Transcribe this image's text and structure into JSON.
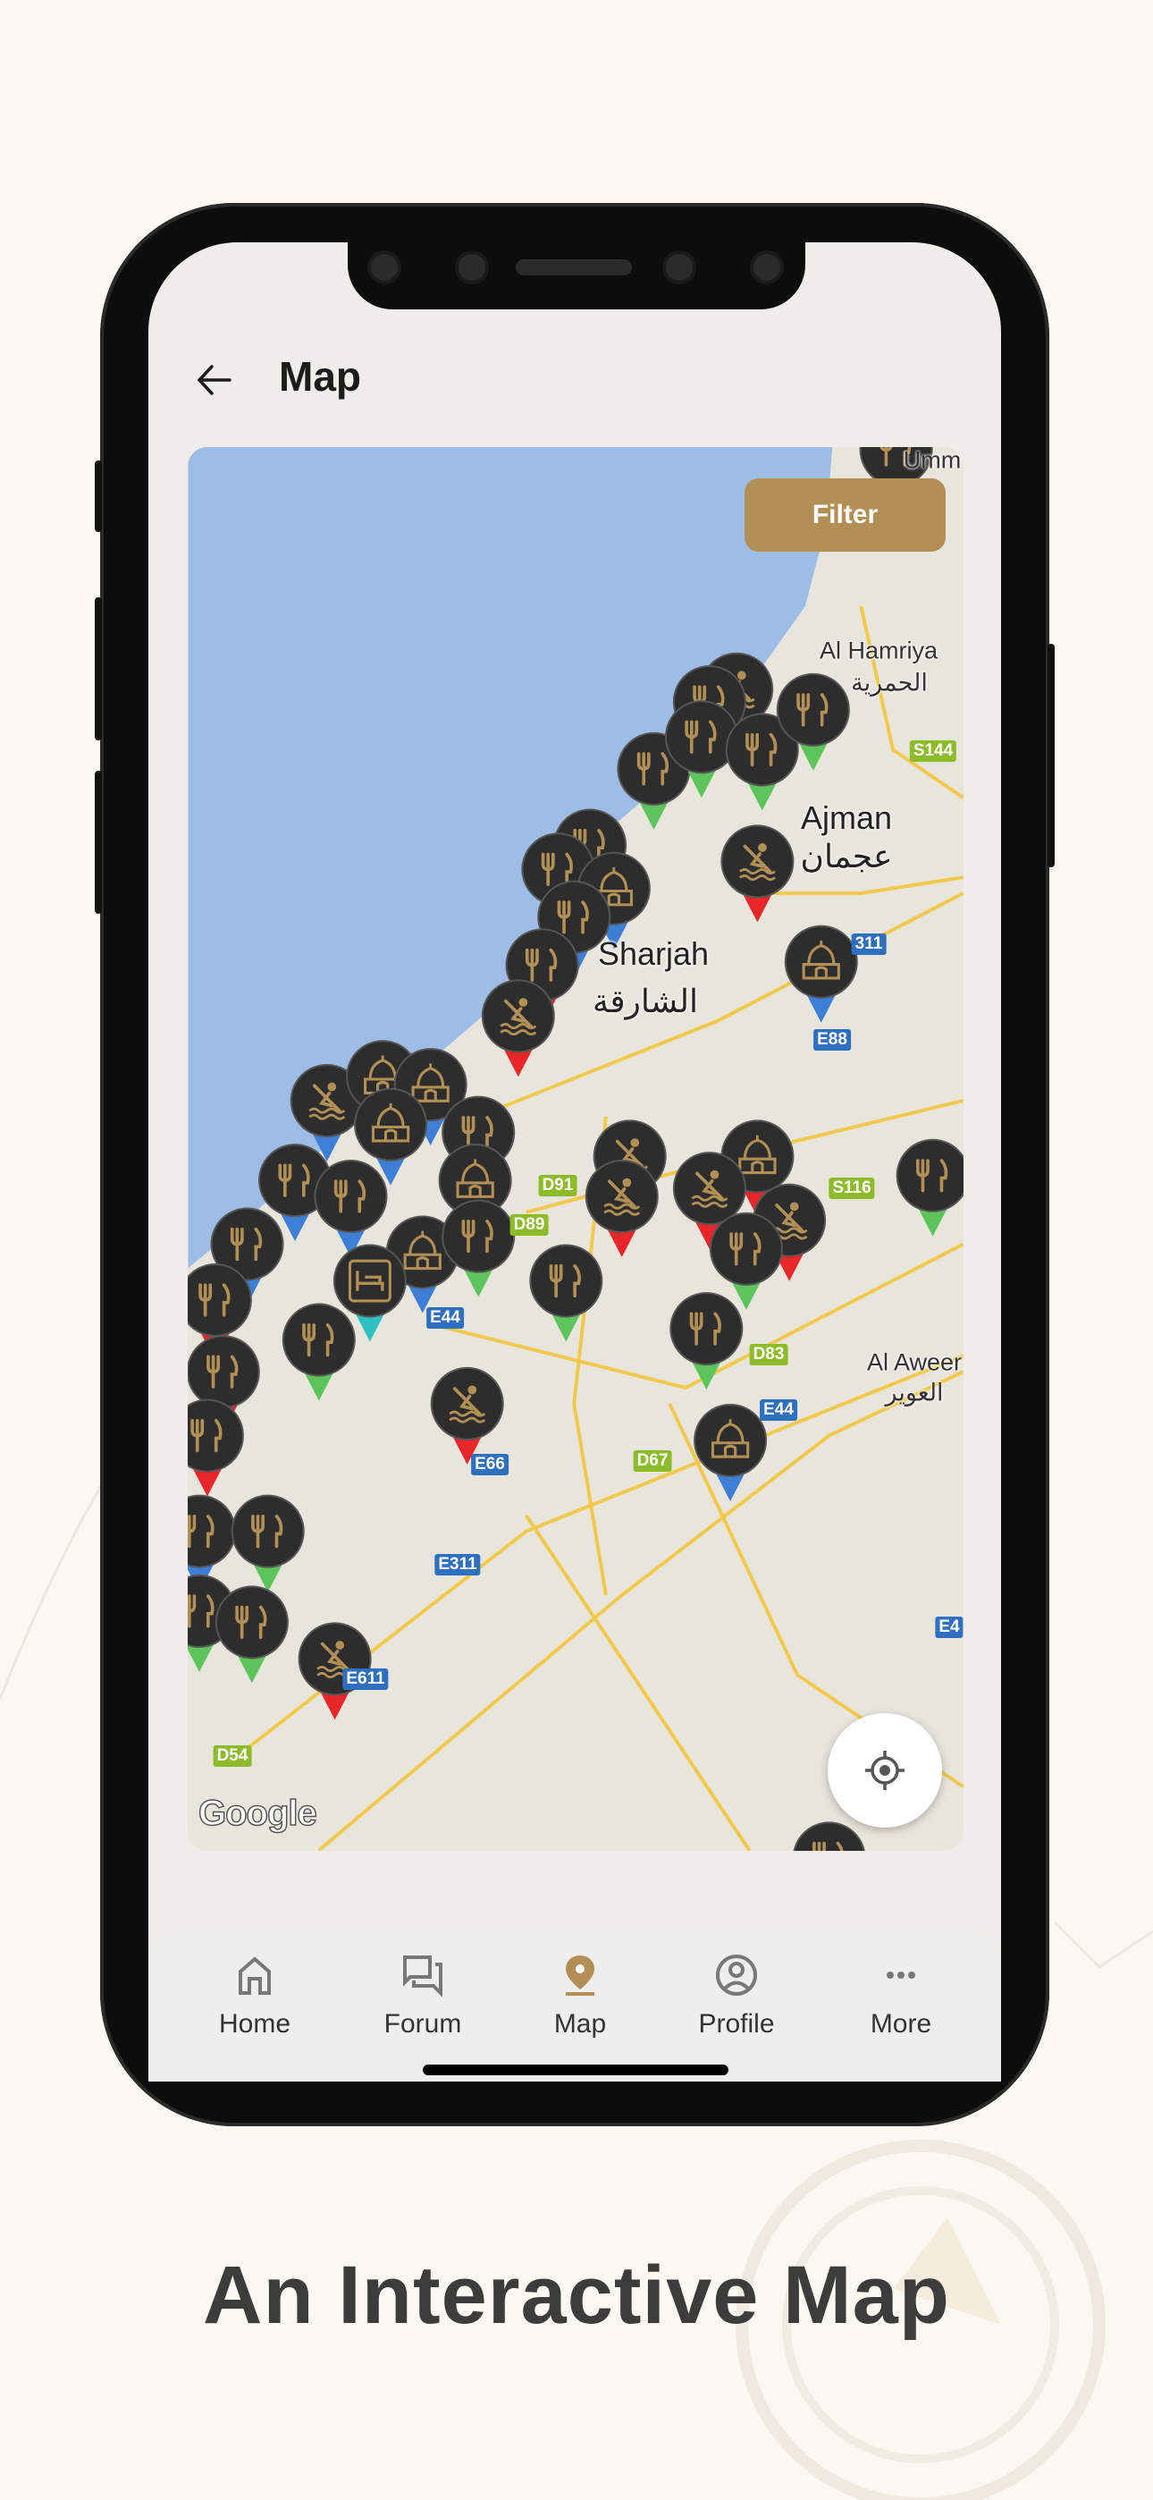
{
  "header": {
    "title": "Map",
    "back_icon": "arrow-left-icon"
  },
  "map": {
    "filter_label": "Filter",
    "attribution": "Google",
    "colors": {
      "water": "#9dbce6",
      "land": "#e8e5dc",
      "road": "#f2c94c",
      "pin_green": "#5cc45a",
      "pin_red": "#e8262a",
      "pin_blue": "#3d7fd6",
      "pin_teal": "#2fc1c1",
      "marker_body": "#2d2d2d",
      "marker_icon": "#b28f54"
    },
    "labels": {
      "umm": "Umm A",
      "al_hamriya": "Al Hamriya",
      "al_hamriya_ar": "الحمرية",
      "ajman": "Ajman",
      "ajman_ar": "عجمان",
      "sharjah": "Sharjah",
      "sharjah_ar": "الشارقة",
      "al_aweer": "Al Aweer",
      "al_aweer_ar": "العوير"
    },
    "road_shields": {
      "s144": "S144",
      "e311a": "311",
      "e88": "E88",
      "s116": "S116",
      "d91": "D91",
      "d89": "D89",
      "d83": "D83",
      "e44a": "E44",
      "e44b": "E44",
      "d67": "D67",
      "e66": "E66",
      "e311": "E311",
      "e611": "E611",
      "d54": "D54",
      "e4": "E4"
    },
    "marker_types": [
      "restaurant",
      "kayaking",
      "mosque",
      "hotel"
    ]
  },
  "nav": {
    "active": "Map",
    "active_color": "#b28f54",
    "items": [
      {
        "label": "Home",
        "icon": "home-icon"
      },
      {
        "label": "Forum",
        "icon": "chat-icon"
      },
      {
        "label": "Map",
        "icon": "map-pin-icon"
      },
      {
        "label": "Profile",
        "icon": "profile-icon"
      },
      {
        "label": "More",
        "icon": "more-icon"
      }
    ]
  },
  "caption": "An Interactive Map"
}
